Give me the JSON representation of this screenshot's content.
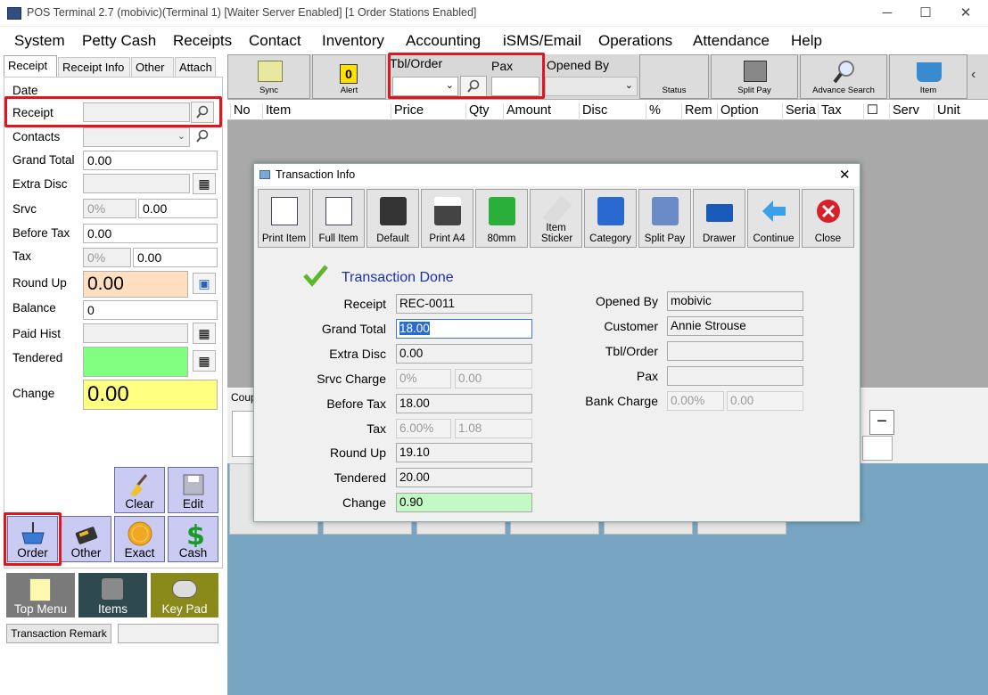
{
  "window": {
    "title": "POS Terminal 2.7 (mobivic)(Terminal 1) [Waiter Server Enabled] [1 Order Stations Enabled]",
    "minimize": "─",
    "maximize": "☐",
    "close": "✕"
  },
  "menu": [
    "System",
    "Petty Cash",
    "Receipts",
    "Contact",
    "Inventory",
    "Accounting",
    "iSMS/Email",
    "Operations",
    "Attendance",
    "Help"
  ],
  "left_tabs": [
    "Receipt",
    "Receipt Info",
    "Other",
    "Attach"
  ],
  "left_fields": {
    "date_label": "Date",
    "receipt_label": "Receipt",
    "contacts_label": "Contacts",
    "grand_total_label": "Grand Total",
    "grand_total_value": "0.00",
    "extra_disc_label": "Extra Disc",
    "srvc_label": "Srvc",
    "srvc_pct": "0%",
    "srvc_value": "0.00",
    "before_tax_label": "Before Tax",
    "before_tax_value": "0.00",
    "tax_label": "Tax",
    "tax_pct": "0%",
    "tax_value": "0.00",
    "round_up_label": "Round Up",
    "round_up_value": "0.00",
    "balance_label": "Balance",
    "balance_value": "0",
    "paid_hist_label": "Paid Hist",
    "tendered_label": "Tendered",
    "change_label": "Change",
    "change_value": "0.00"
  },
  "action_buttons": {
    "clear": "Clear",
    "edit": "Edit",
    "order": "Order",
    "other": "Other",
    "exact": "Exact",
    "cash": "Cash",
    "top_menu": "Top Menu",
    "items": "Items",
    "key_pad": "Key Pad",
    "transaction_remark": "Transaction Remark"
  },
  "toolbar": {
    "sync": "Sync",
    "alert": "Alert",
    "alert_count": "0",
    "tbl_order": "Tbl/Order",
    "pax": "Pax",
    "opened_by": "Opened By",
    "status": "Status",
    "split_pay": "Split Pay",
    "advance_search": "Advance Search",
    "item": "Item",
    "collapse": "‹"
  },
  "columns": [
    "No",
    "Item",
    "Price",
    "Qty",
    "Amount",
    "Disc",
    "%",
    "Rem",
    "Option",
    "Seria",
    "Tax",
    "☐",
    "Serv",
    "Unit"
  ],
  "coupon_label": "Coup",
  "dialog": {
    "title": "Transaction Info",
    "close": "✕",
    "buttons": [
      "Print Item",
      "Full Item",
      "Default",
      "Print A4",
      "80mm",
      "Item Sticker",
      "Category",
      "Split Pay",
      "Drawer",
      "Continue",
      "Close"
    ],
    "status": "Transaction Done",
    "receipt_label": "Receipt",
    "receipt_value": "REC-0011",
    "grand_total_label": "Grand Total",
    "grand_total_value": "18.00",
    "extra_disc_label": "Extra Disc",
    "extra_disc_value": "0.00",
    "srvc_charge_label": "Srvc Charge",
    "srvc_charge_pct": "0%",
    "srvc_charge_value": "0.00",
    "before_tax_label": "Before Tax",
    "before_tax_value": "18.00",
    "tax_label": "Tax",
    "tax_pct": "6.00%",
    "tax_value": "1.08",
    "round_up_label": "Round Up",
    "round_up_value": "19.10",
    "tendered_label": "Tendered",
    "tendered_value": "20.00",
    "change_label": "Change",
    "change_value": "0.90",
    "opened_by_label": "Opened By",
    "opened_by_value": "mobivic",
    "customer_label": "Customer",
    "customer_value": "Annie Strouse",
    "tbl_order_label": "Tbl/Order",
    "pax_label": "Pax",
    "bank_charge_label": "Bank Charge",
    "bank_charge_pct": "0.00%",
    "bank_charge_value": "0.00"
  },
  "colors": {
    "highlight_red": "#e0161f",
    "round_up_bg": "#ffdfbf",
    "tendered_bg": "#80ff80",
    "change_bg": "#ffff80",
    "button_purple": "#c9cbf2",
    "check_green": "#5cb82a",
    "status_blue": "#1c2fb8"
  }
}
